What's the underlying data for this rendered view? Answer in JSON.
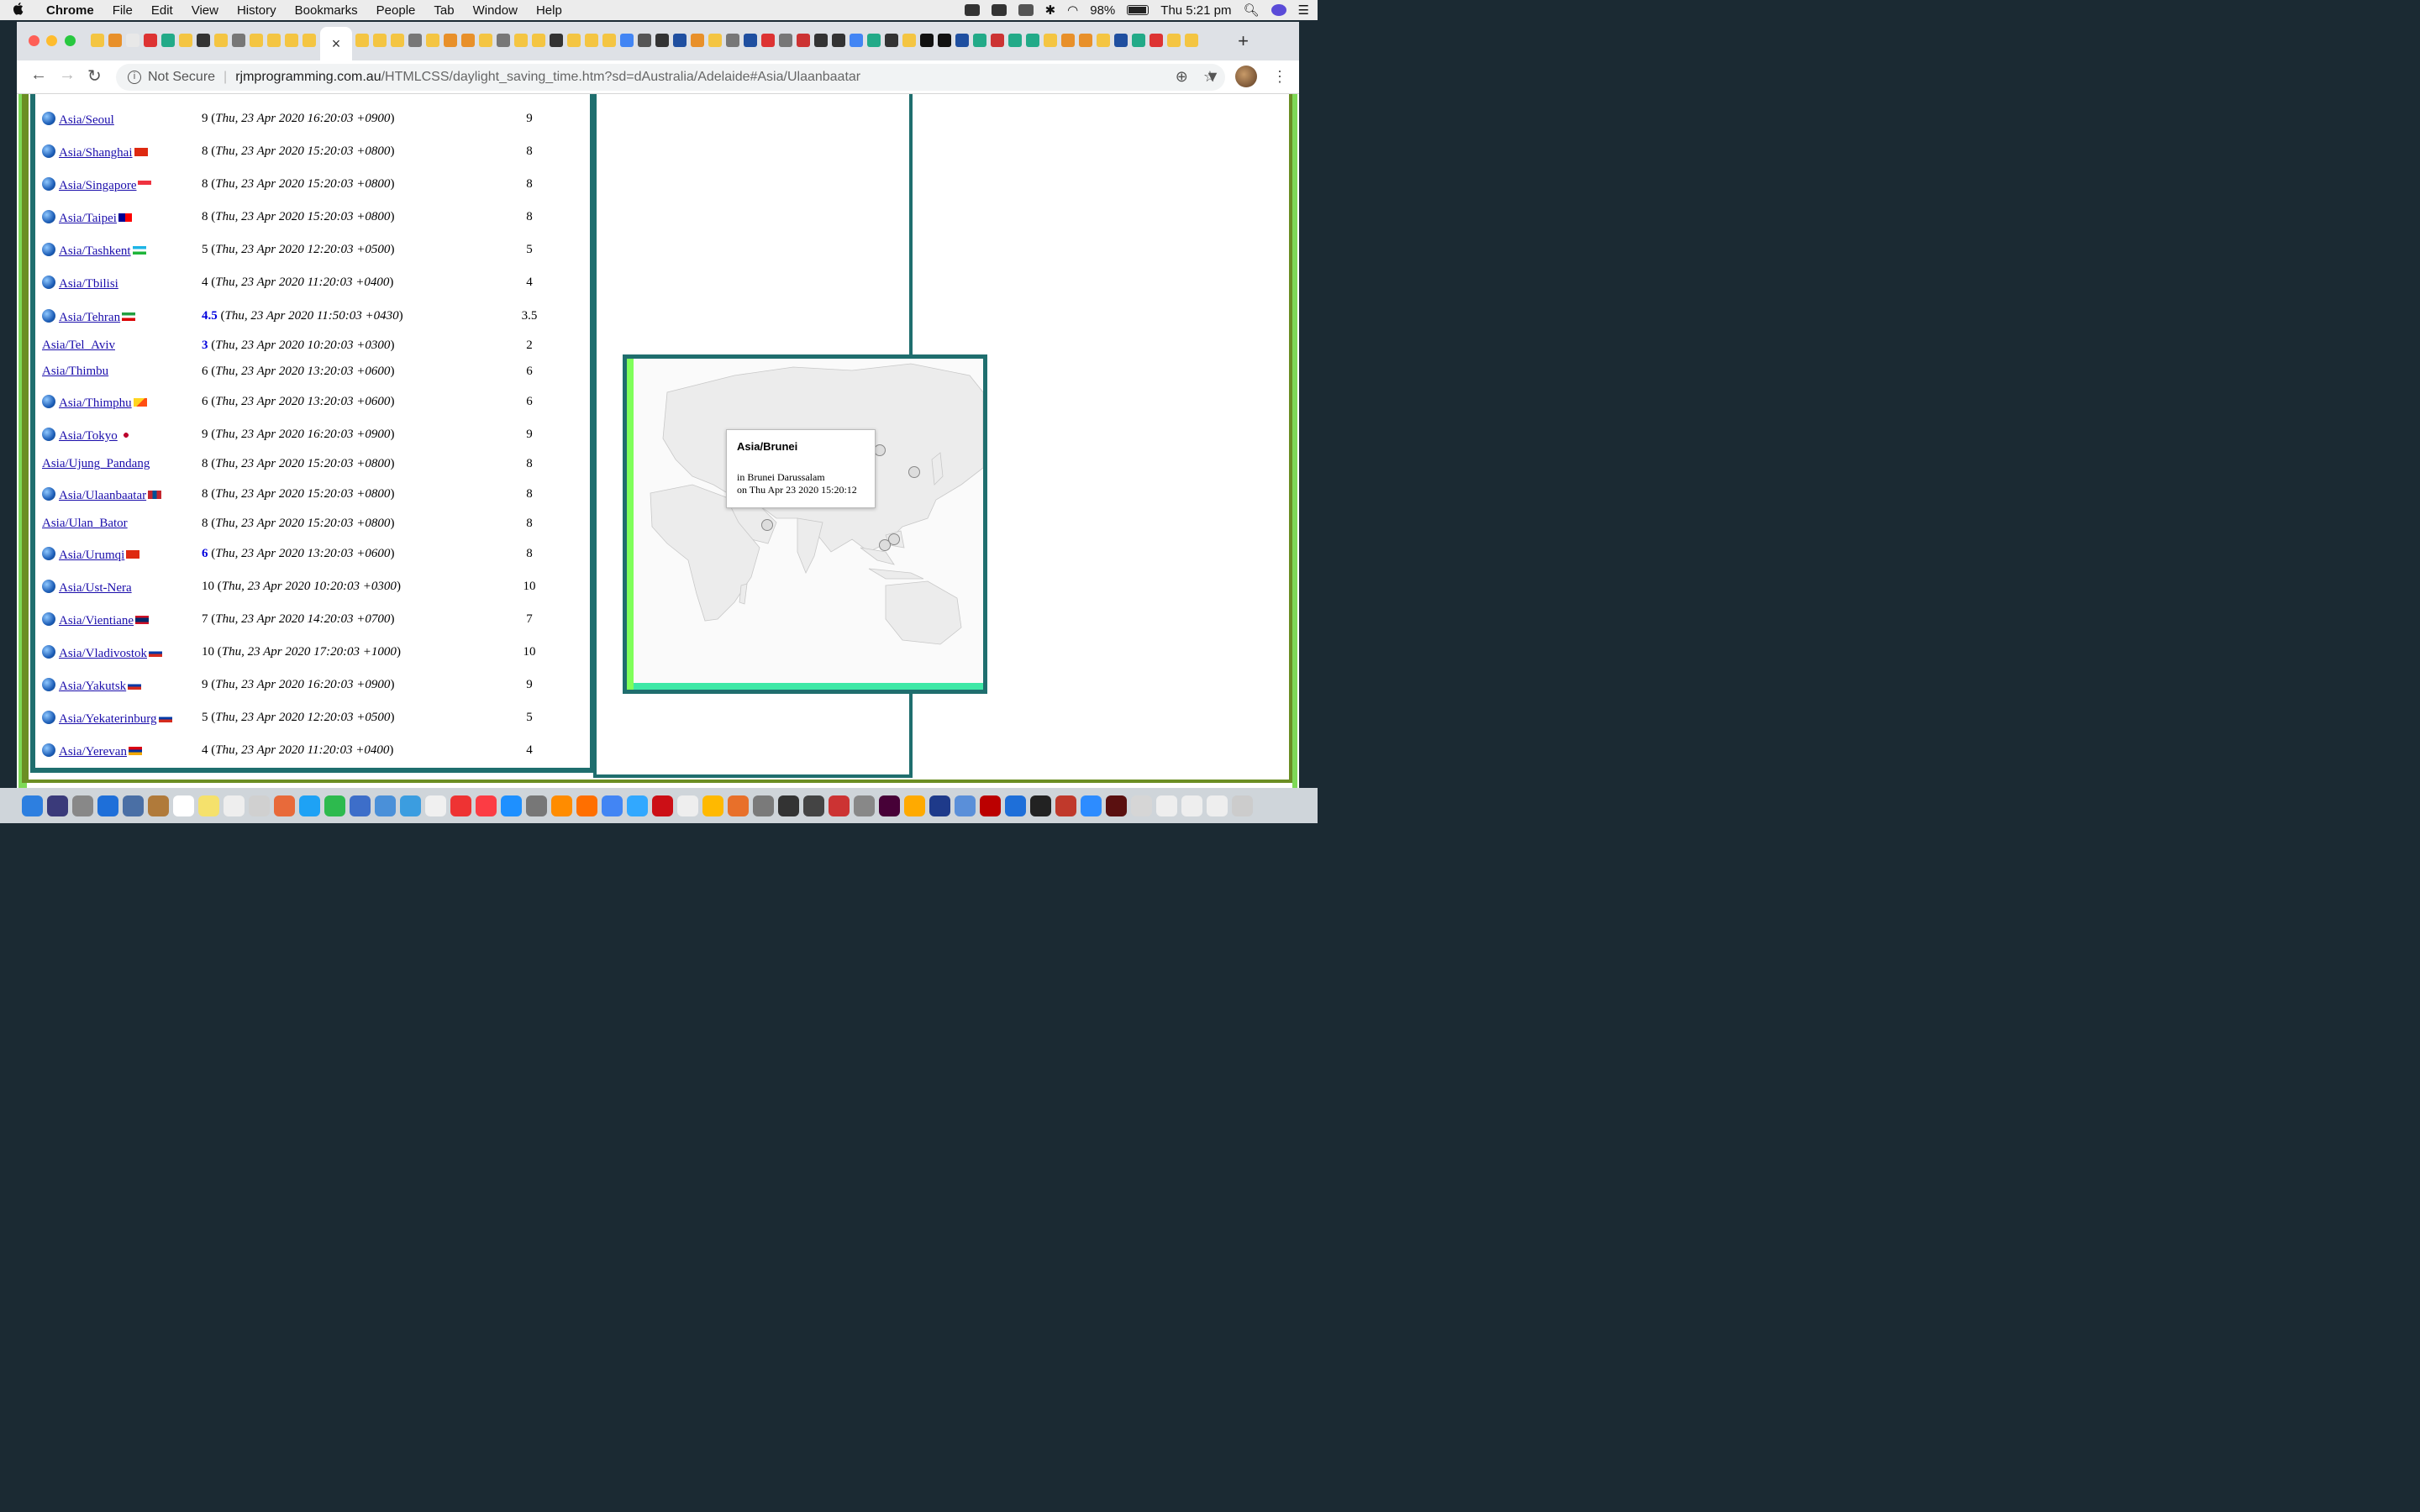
{
  "menubar": {
    "apple": "",
    "app": "Chrome",
    "items": [
      "File",
      "Edit",
      "View",
      "History",
      "Bookmarks",
      "People",
      "Tab",
      "Window",
      "Help"
    ],
    "battery": "98%",
    "clock": "Thu 5:21 pm"
  },
  "browser": {
    "tab_close": "×",
    "new_tab": "+",
    "security_label": "Not Secure",
    "url_host": "rjmprogramming.com.au",
    "url_path": "/HTMLCSS/daylight_saving_time.htm?sd=dAustralia/Adelaide#Asia/Ulaanbaatar"
  },
  "rows": [
    {
      "city": "Asia/Seoul",
      "globe": true,
      "flag": "kr",
      "offset": "9",
      "highlight": false,
      "stamp": "Thu, 23 Apr 2020 16:20:03 +0900",
      "std": "9"
    },
    {
      "city": "Asia/Shanghai",
      "globe": true,
      "flag": "cn",
      "offset": "8",
      "highlight": false,
      "stamp": "Thu, 23 Apr 2020 15:20:03 +0800",
      "std": "8"
    },
    {
      "city": "Asia/Singapore",
      "globe": true,
      "flag": "sg",
      "offset": "8",
      "highlight": false,
      "stamp": "Thu, 23 Apr 2020 15:20:03 +0800",
      "std": "8"
    },
    {
      "city": "Asia/Taipei",
      "globe": true,
      "flag": "tw",
      "offset": "8",
      "highlight": false,
      "stamp": "Thu, 23 Apr 2020 15:20:03 +0800",
      "std": "8"
    },
    {
      "city": "Asia/Tashkent",
      "globe": true,
      "flag": "uz",
      "offset": "5",
      "highlight": false,
      "stamp": "Thu, 23 Apr 2020 12:20:03 +0500",
      "std": "5"
    },
    {
      "city": "Asia/Tbilisi",
      "globe": true,
      "flag": "ge",
      "offset": "4",
      "highlight": false,
      "stamp": "Thu, 23 Apr 2020 11:20:03 +0400",
      "std": "4"
    },
    {
      "city": "Asia/Tehran",
      "globe": true,
      "flag": "ir",
      "offset": "4.5",
      "highlight": true,
      "stamp": "Thu, 23 Apr 2020 11:50:03 +0430",
      "std": "3.5"
    },
    {
      "city": "Asia/Tel_Aviv",
      "globe": false,
      "flag": "",
      "offset": "3",
      "highlight": true,
      "stamp": "Thu, 23 Apr 2020 10:20:03 +0300",
      "std": "2"
    },
    {
      "city": "Asia/Thimbu",
      "globe": false,
      "flag": "",
      "offset": "6",
      "highlight": false,
      "stamp": "Thu, 23 Apr 2020 13:20:03 +0600",
      "std": "6"
    },
    {
      "city": "Asia/Thimphu",
      "globe": true,
      "flag": "bt",
      "offset": "6",
      "highlight": false,
      "stamp": "Thu, 23 Apr 2020 13:20:03 +0600",
      "std": "6"
    },
    {
      "city": "Asia/Tokyo",
      "globe": true,
      "flag": "jp",
      "offset": "9",
      "highlight": false,
      "stamp": "Thu, 23 Apr 2020 16:20:03 +0900",
      "std": "9"
    },
    {
      "city": "Asia/Ujung_Pandang",
      "globe": false,
      "flag": "",
      "offset": "8",
      "highlight": false,
      "stamp": "Thu, 23 Apr 2020 15:20:03 +0800",
      "std": "8"
    },
    {
      "city": "Asia/Ulaanbaatar",
      "globe": true,
      "flag": "mn",
      "offset": "8",
      "highlight": false,
      "stamp": "Thu, 23 Apr 2020 15:20:03 +0800",
      "std": "8"
    },
    {
      "city": "Asia/Ulan_Bator",
      "globe": false,
      "flag": "",
      "offset": "8",
      "highlight": false,
      "stamp": "Thu, 23 Apr 2020 15:20:03 +0800",
      "std": "8"
    },
    {
      "city": "Asia/Urumqi",
      "globe": true,
      "flag": "cn",
      "offset": "6",
      "highlight": true,
      "stamp": "Thu, 23 Apr 2020 13:20:03 +0600",
      "std": "8"
    },
    {
      "city": "Asia/Ust-Nera",
      "globe": true,
      "flag": "",
      "offset": "10",
      "highlight": false,
      "stamp": "Thu, 23 Apr 2020 10:20:03 +0300",
      "std": "10"
    },
    {
      "city": "Asia/Vientiane",
      "globe": true,
      "flag": "la",
      "offset": "7",
      "highlight": false,
      "stamp": "Thu, 23 Apr 2020 14:20:03 +0700",
      "std": "7"
    },
    {
      "city": "Asia/Vladivostok",
      "globe": true,
      "flag": "ru",
      "offset": "10",
      "highlight": false,
      "stamp": "Thu, 23 Apr 2020 17:20:03 +1000",
      "std": "10"
    },
    {
      "city": "Asia/Yakutsk",
      "globe": true,
      "flag": "ru",
      "offset": "9",
      "highlight": false,
      "stamp": "Thu, 23 Apr 2020 16:20:03 +0900",
      "std": "9"
    },
    {
      "city": "Asia/Yekaterinburg",
      "globe": true,
      "flag": "ru",
      "offset": "5",
      "highlight": false,
      "stamp": "Thu, 23 Apr 2020 12:20:03 +0500",
      "std": "5"
    },
    {
      "city": "Asia/Yerevan",
      "globe": true,
      "flag": "am",
      "offset": "4",
      "highlight": false,
      "stamp": "Thu, 23 Apr 2020 11:20:03 +0400",
      "std": "4"
    }
  ],
  "map": {
    "tooltip_title": "Asia/Brunei",
    "tooltip_country": "in Brunei Darussalam",
    "tooltip_time": "on Thu Apr 23 2020 15:20:12",
    "marker_count": 5
  },
  "colors": {
    "frame_teal": "#1f6e6e",
    "frame_green": "#7ed957",
    "frame_olive": "#6b8e23",
    "link": "#1a0dab",
    "highlight_offset": "#0000dd",
    "map_strip_left": "#7fff5a",
    "map_strip_bottom": "#3ee8a6"
  }
}
